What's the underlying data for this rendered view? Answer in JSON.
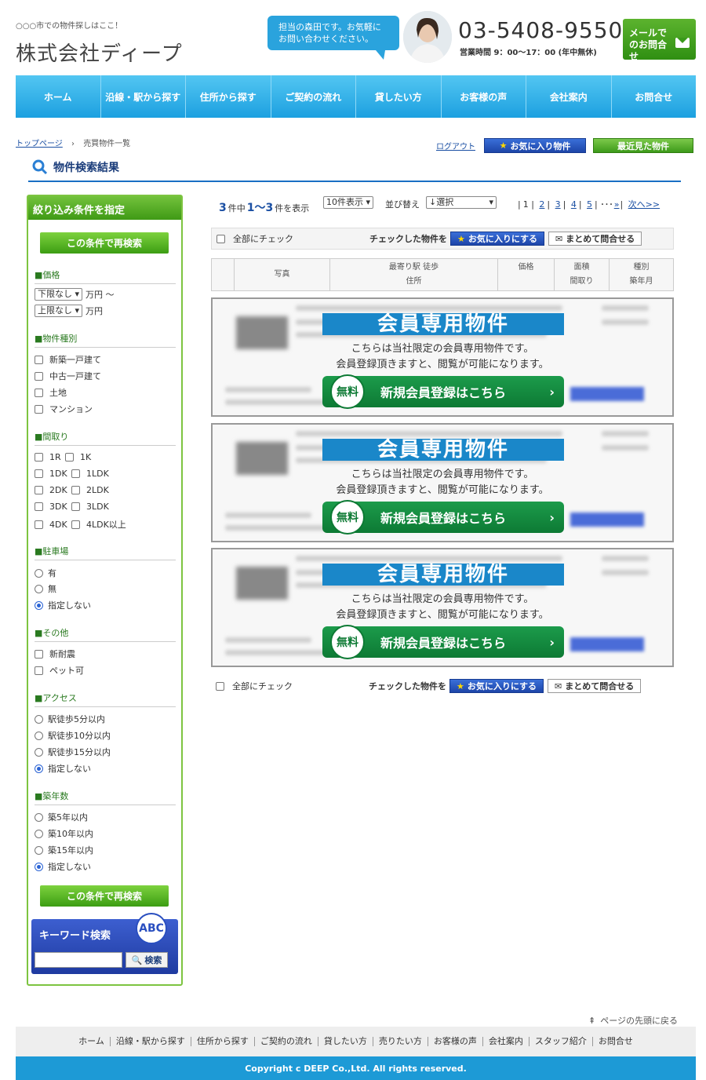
{
  "header": {
    "tagline": "○○○市での物件探しはここ！",
    "company": "株式会社ディープ",
    "bubble": "担当の森田です。お気軽にお問い合わせください。",
    "phone": "03-5408-9550",
    "hours": "営業時間 9：00〜17：00 (年中無休)",
    "mail_label": "メールでのお問合せ"
  },
  "nav": [
    "ホーム",
    "沿線・駅から探す",
    "住所から探す",
    "ご契約の流れ",
    "貸したい方",
    "お客様の声",
    "会社案内",
    "お問合せ"
  ],
  "breadcrumb": {
    "top": "トップページ",
    "sep": "›",
    "current": "売買物件一覧"
  },
  "account": {
    "logout": "ログアウト",
    "favorites": "お気に入り物件",
    "recent": "最近見た物件"
  },
  "page_title": "物件検索結果",
  "sidebar": {
    "title": "絞り込み条件を指定",
    "research": "この条件で再検索",
    "price": {
      "title": "■価格",
      "min": "下限なし",
      "min_unit": "万円 〜",
      "max": "上限なし",
      "max_unit": "万円"
    },
    "type": {
      "title": "■物件種別",
      "options": [
        "新築一戸建て",
        "中古一戸建て",
        "土地",
        "マンション"
      ]
    },
    "layout": {
      "title": "■間取り",
      "options": [
        "1R",
        "1K",
        "1DK",
        "1LDK",
        "2DK",
        "2LDK",
        "3DK",
        "3LDK",
        "4DK",
        "4LDK以上"
      ]
    },
    "parking": {
      "title": "■駐車場",
      "options": [
        "有",
        "無",
        "指定しない"
      ]
    },
    "other": {
      "title": "■その他",
      "options": [
        "新耐震",
        "ペット可"
      ]
    },
    "access": {
      "title": "■アクセス",
      "options": [
        "駅徒歩5分以内",
        "駅徒歩10分以内",
        "駅徒歩15分以内",
        "指定しない"
      ]
    },
    "age": {
      "title": "■築年数",
      "options": [
        "築5年以内",
        "築10年以内",
        "築15年以内",
        "指定しない"
      ]
    },
    "keyword": {
      "title": "キーワード検索",
      "badge": "ABC",
      "button": "検索",
      "placeholder": ""
    }
  },
  "results": {
    "total": "3",
    "total_unit": "件中",
    "range": "1〜3",
    "range_unit": "件を表示",
    "per_page": "10件表示",
    "sort_label": "並び替え",
    "sort_value": "↓選択",
    "pages": [
      "1",
      "2",
      "3",
      "4",
      "5"
    ],
    "ellipsis": "･･･",
    "last": "»",
    "next": "次へ>>"
  },
  "checkbar": {
    "all": "全部にチェック",
    "checked": "チェックした物件を",
    "fav": "お気に入りにする",
    "inquire": "まとめて問合せる"
  },
  "table": {
    "photo": "写真",
    "station": "最寄り駅 徒歩",
    "address": "住所",
    "price": "価格",
    "area": "面積",
    "layout": "間取り",
    "kind": "種別",
    "built": "築年月"
  },
  "cards": [
    {
      "banner": "会員専用物件",
      "line1": "こちらは当社限定の会員専用物件です。",
      "line2": "会員登録頂きますと、閲覧が可能になります。",
      "free": "無料",
      "register": "新規会員登録はこちら"
    },
    {
      "banner": "会員専用物件",
      "line1": "こちらは当社限定の会員専用物件です。",
      "line2": "会員登録頂きますと、閲覧が可能になります。",
      "free": "無料",
      "register": "新規会員登録はこちら"
    },
    {
      "banner": "会員専用物件",
      "line1": "こちらは当社限定の会員専用物件です。",
      "line2": "会員登録頂きますと、閲覧が可能になります。",
      "free": "無料",
      "register": "新規会員登録はこちら"
    }
  ],
  "footer": {
    "totop": "ページの先頭に戻る",
    "links": [
      "ホーム",
      "沿線・駅から探す",
      "住所から探す",
      "ご契約の流れ",
      "貸したい方",
      "売りたい方",
      "お客様の声",
      "会社案内",
      "スタッフ紹介",
      "お問合せ"
    ],
    "copyright": "Copyright c DEEP Co.,Ltd. All rights reserved."
  },
  "colors": {
    "nav": "#1ca0e0",
    "green": "#3f9a15",
    "blue": "#1d45a8",
    "register": "#0d7a34"
  }
}
